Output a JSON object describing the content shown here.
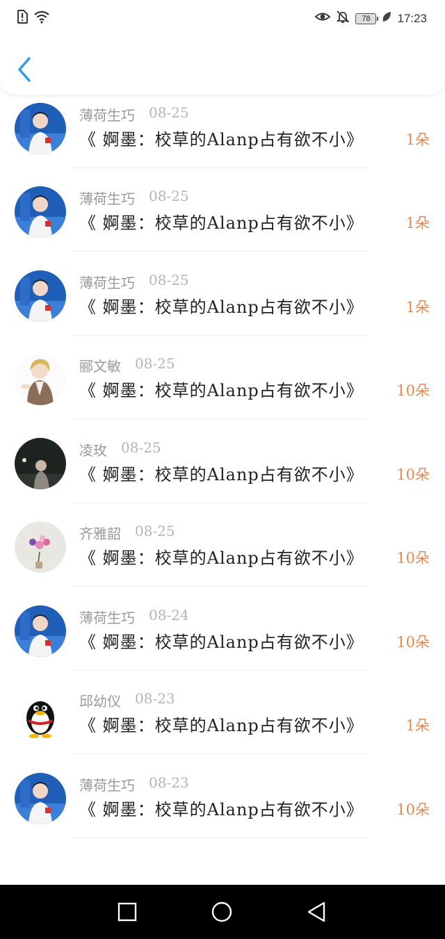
{
  "status_bar": {
    "time": "17:23",
    "battery": "78",
    "icons": [
      "sim-alert-icon",
      "wifi-icon",
      "eye-icon",
      "bell-off-icon",
      "battery-icon",
      "leaf-icon"
    ]
  },
  "header": {
    "back_icon": "chevron-left-icon"
  },
  "colors": {
    "accent": "#2b9ce8",
    "count": "#e8874e",
    "name": "#9a9a9a",
    "title": "#222222"
  },
  "items": [
    {
      "name": "",
      "date": "",
      "title": "《 婀墨：校草的Alanp占有欲不小》",
      "count": "1朵",
      "avatar": "boy-blue"
    },
    {
      "name": "薄荷生巧",
      "date": "08-25",
      "title": "《 婀墨：校草的Alanp占有欲不小》",
      "count": "1朵",
      "avatar": "boy-blue"
    },
    {
      "name": "薄荷生巧",
      "date": "08-25",
      "title": "《 婀墨：校草的Alanp占有欲不小》",
      "count": "1朵",
      "avatar": "boy-blue"
    },
    {
      "name": "薄荷生巧",
      "date": "08-25",
      "title": "《 婀墨：校草的Alanp占有欲不小》",
      "count": "1朵",
      "avatar": "boy-blue"
    },
    {
      "name": "郦文敏",
      "date": "08-25",
      "title": "《 婀墨：校草的Alanp占有欲不小》",
      "count": "10朵",
      "avatar": "anime"
    },
    {
      "name": "凌玫",
      "date": "08-25",
      "title": "《 婀墨：校草的Alanp占有欲不小》",
      "count": "10朵",
      "avatar": "night"
    },
    {
      "name": "齐雅韶",
      "date": "08-25",
      "title": "《 婀墨：校草的Alanp占有欲不小》",
      "count": "10朵",
      "avatar": "flower"
    },
    {
      "name": "薄荷生巧",
      "date": "08-24",
      "title": "《 婀墨：校草的Alanp占有欲不小》",
      "count": "10朵",
      "avatar": "boy-blue"
    },
    {
      "name": "邱幼仪",
      "date": "08-23",
      "title": "《 婀墨：校草的Alanp占有欲不小》",
      "count": "1朵",
      "avatar": "penguin"
    },
    {
      "name": "薄荷生巧",
      "date": "08-23",
      "title": "《 婀墨：校草的Alanp占有欲不小》",
      "count": "10朵",
      "avatar": "boy-blue"
    }
  ],
  "navbar": {
    "icons": [
      "recent-apps-icon",
      "home-icon",
      "back-triangle-icon"
    ]
  }
}
